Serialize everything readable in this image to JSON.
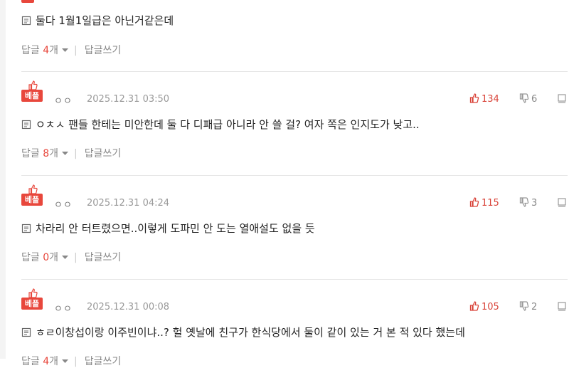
{
  "colors": {
    "accent": "#e8473c",
    "muted": "#888888",
    "divider": "#e6e6e6"
  },
  "first_comment": {
    "text": "둘다 1월1일급은 아닌거같은데",
    "reply_label": "답글",
    "reply_count": "4",
    "reply_unit": "개",
    "write_label": "답글쓰기"
  },
  "comments": [
    {
      "badge": "베플",
      "author": "ㅇㅇ",
      "date": "2025.12.31 03:50",
      "up": "134",
      "down": "6",
      "text": "ㅇㅊㅅ 팬들 한테는 미안한데 둘 다 디패급 아니라 안 쓸 걸? 여자 쪽은 인지도가 낮고..",
      "reply_label": "답글",
      "reply_count": "8",
      "reply_unit": "개",
      "write_label": "답글쓰기"
    },
    {
      "badge": "베플",
      "author": "ㅇㅇ",
      "date": "2025.12.31 04:24",
      "up": "115",
      "down": "3",
      "text": "차라리 안 터트렸으면..이렇게 도파민 안 도는 열애설도 없을 듯",
      "reply_label": "답글",
      "reply_count": "0",
      "reply_unit": "개",
      "write_label": "답글쓰기"
    },
    {
      "badge": "베플",
      "author": "ㅇㅇ",
      "date": "2025.12.31 00:08",
      "up": "105",
      "down": "2",
      "text": "ㅎㄹ이창섭이랑 이주빈이냐..? 헐 옛날에 친구가 한식당에서 둘이 같이 있는 거 본 적 있다 했는데",
      "reply_label": "답글",
      "reply_count": "4",
      "reply_unit": "개",
      "write_label": "답글쓰기"
    }
  ],
  "icons": {
    "memo": "memo-icon",
    "thumb_up": "thumbs-up-icon",
    "thumb_down": "thumbs-down-icon",
    "report": "report-icon",
    "caret": "chevron-down-icon"
  }
}
